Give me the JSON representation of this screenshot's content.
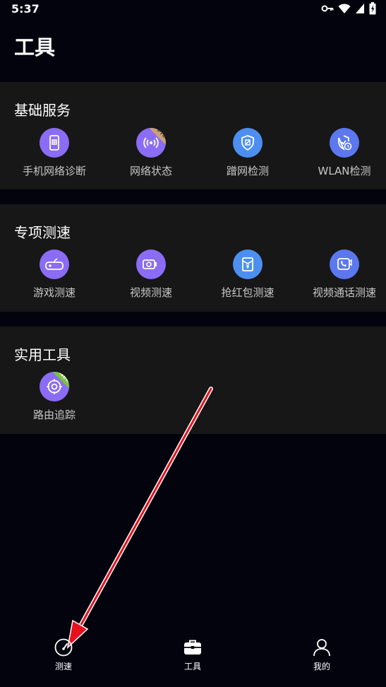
{
  "status_bar": {
    "time": "5:37",
    "icons": [
      "key-icon",
      "wifi-icon",
      "signal-icon",
      "battery-icon"
    ]
  },
  "header": {
    "title": "工具"
  },
  "sections": [
    {
      "title": "基础服务",
      "items": [
        {
          "label": "手机网络诊断",
          "icon": "phone-icon",
          "color": "#8b6cf5"
        },
        {
          "label": "网络状态",
          "icon": "wireless-icon",
          "color": "#8b6cf5",
          "badge": "Pro"
        },
        {
          "label": "蹭网检测",
          "icon": "shield-icon",
          "color": "#4d8ff0"
        },
        {
          "label": "WLAN检测",
          "icon": "shield-clock-icon",
          "color": "#5b78ef"
        }
      ]
    },
    {
      "title": "专项测速",
      "items": [
        {
          "label": "游戏测速",
          "icon": "gamepad-icon",
          "color": "#8b6cf5"
        },
        {
          "label": "视频测速",
          "icon": "video-camera-icon",
          "color": "#8b6cf5"
        },
        {
          "label": "抢红包测速",
          "icon": "red-packet-icon",
          "color": "#4d8ff0"
        },
        {
          "label": "视频通话测速",
          "icon": "video-call-icon",
          "color": "#5b78ef"
        }
      ]
    },
    {
      "title": "实用工具",
      "items": [
        {
          "label": "路由追踪",
          "icon": "route-trace-icon",
          "color": "#8b6cf5",
          "badge": "New"
        }
      ]
    }
  ],
  "bottom_nav": [
    {
      "label": "测速",
      "icon": "speedometer-icon"
    },
    {
      "label": "工具",
      "icon": "toolbox-icon",
      "active": true
    },
    {
      "label": "我的",
      "icon": "profile-icon"
    }
  ],
  "colors": {
    "background": "#03030e",
    "section_bg": "#171717",
    "pro_badge": "#c9a27a",
    "new_badge": "#7bc043",
    "arrow": "#e8101c"
  }
}
